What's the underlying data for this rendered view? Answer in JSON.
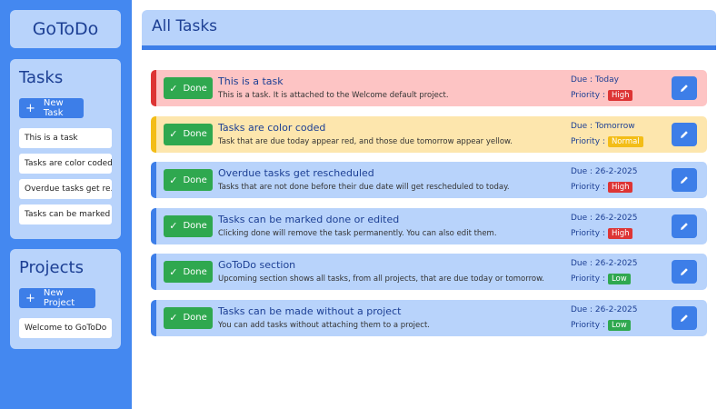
{
  "app": {
    "logo": "GoToDo"
  },
  "sidebar": {
    "tasks_title": "Tasks",
    "new_task_label": "New Task",
    "task_items": [
      "This is a task",
      "Tasks are color coded",
      "Overdue tasks get re...",
      "Tasks can be marked ..."
    ],
    "projects_title": "Projects",
    "new_project_label": "New Project",
    "project_items": [
      "Welcome to GoToDo"
    ]
  },
  "header": {
    "title": "All Tasks"
  },
  "done_label": "Done",
  "colors": {
    "sidebar": "#4488f0",
    "accent": "#3d7ee8",
    "red_task": "#fdc4c4",
    "yellow_task": "#fde6ad",
    "blue_task": "#b8d3fb",
    "done_green": "#2fa84f"
  },
  "tasks": [
    {
      "title": "This is a task",
      "description": "This is a task. It is attached to the Welcome default project.",
      "due": "Due : Today",
      "priority_label": "Priority :",
      "priority": "High",
      "color": "red"
    },
    {
      "title": "Tasks are color coded",
      "description": "Task that are due today appear red, and those due tomorrow appear yellow.",
      "due": "Due : Tomorrow",
      "priority_label": "Priority :",
      "priority": "Normal",
      "color": "yellow"
    },
    {
      "title": "Overdue tasks get rescheduled",
      "description": "Tasks that are not done before their due date will get rescheduled to today.",
      "due": "Due : 26-2-2025",
      "priority_label": "Priority :",
      "priority": "High",
      "color": "blue"
    },
    {
      "title": "Tasks can be marked done or edited",
      "description": "Clicking done will remove the task permanently. You can also edit them.",
      "due": "Due : 26-2-2025",
      "priority_label": "Priority :",
      "priority": "High",
      "color": "blue"
    },
    {
      "title": "GoToDo section",
      "description": "Upcoming section shows all tasks, from all projects, that are due today or tomorrow.",
      "due": "Due : 26-2-2025",
      "priority_label": "Priority :",
      "priority": "Low",
      "color": "blue"
    },
    {
      "title": "Tasks can be made without a project",
      "description": "You can add tasks without attaching them to a project.",
      "due": "Due : 26-2-2025",
      "priority_label": "Priority :",
      "priority": "Low",
      "color": "blue"
    }
  ],
  "icons": {
    "plus": "plus-icon",
    "check": "check-icon",
    "edit": "pencil-icon"
  }
}
